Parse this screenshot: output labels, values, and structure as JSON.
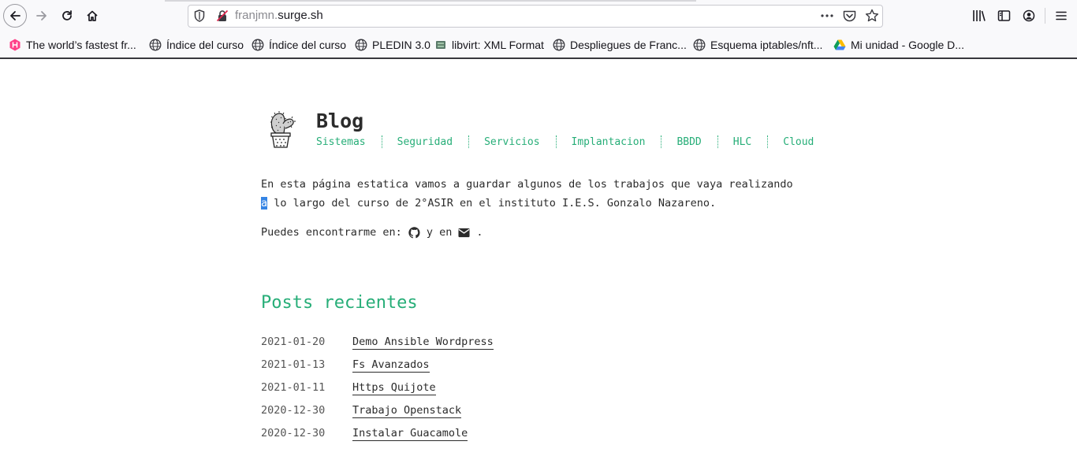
{
  "browser": {
    "url_prefix": "franjmn.",
    "url_domain": "surge.sh",
    "icons": {
      "back": "back-arrow-icon",
      "forward": "forward-arrow-icon",
      "reload": "reload-icon",
      "home": "home-icon",
      "tracking": "shield-icon",
      "insecure": "insecure-lock-icon",
      "more": "more-dots-icon",
      "pocket": "pocket-icon",
      "bookmark": "star-icon",
      "library": "library-icon",
      "sidebar": "sidebar-icon",
      "account": "account-icon",
      "menu": "hamburger-menu-icon"
    },
    "bookmarks": [
      {
        "label": "The world’s fastest fr...",
        "icon": "hugo-icon"
      },
      {
        "label": "Índice del curso",
        "icon": "globe-icon"
      },
      {
        "label": "Índice del curso",
        "icon": "globe-icon"
      },
      {
        "label": "PLEDIN 3.0",
        "icon": "globe-icon"
      },
      {
        "label": "libvirt: XML Format",
        "icon": "libvirt-icon"
      },
      {
        "label": "Despliegues de Franc...",
        "icon": "globe-icon"
      },
      {
        "label": "Esquema iptables/nft...",
        "icon": "globe-icon"
      },
      {
        "label": "Mi unidad - Google D...",
        "icon": "google-drive-icon"
      }
    ]
  },
  "site": {
    "title": "Blog",
    "accent_color": "#27ae78",
    "nav": [
      "Sistemas",
      "Seguridad",
      "Servicios",
      "Implantacion",
      "BBDD",
      "HLC",
      "Cloud"
    ],
    "intro_line1": "En esta página estatica vamos a guardar algunos de los trabajos que vaya realizando",
    "intro_line2_selected": "a",
    "intro_line2_rest": " lo largo del curso de 2°ASIR en el instituto I.E.S. Gonzalo Nazareno.",
    "contact_prefix": "Puedes encontrarme en:",
    "contact_middle": "y en",
    "contact_suffix": ".",
    "posts_heading": "Posts recientes",
    "posts": [
      {
        "date": "2021-01-20",
        "title": "Demo Ansible Wordpress"
      },
      {
        "date": "2021-01-13",
        "title": "Fs Avanzados"
      },
      {
        "date": "2021-01-11",
        "title": "Https Quijote"
      },
      {
        "date": "2020-12-30",
        "title": "Trabajo Openstack"
      },
      {
        "date": "2020-12-30",
        "title": "Instalar Guacamole"
      }
    ]
  }
}
